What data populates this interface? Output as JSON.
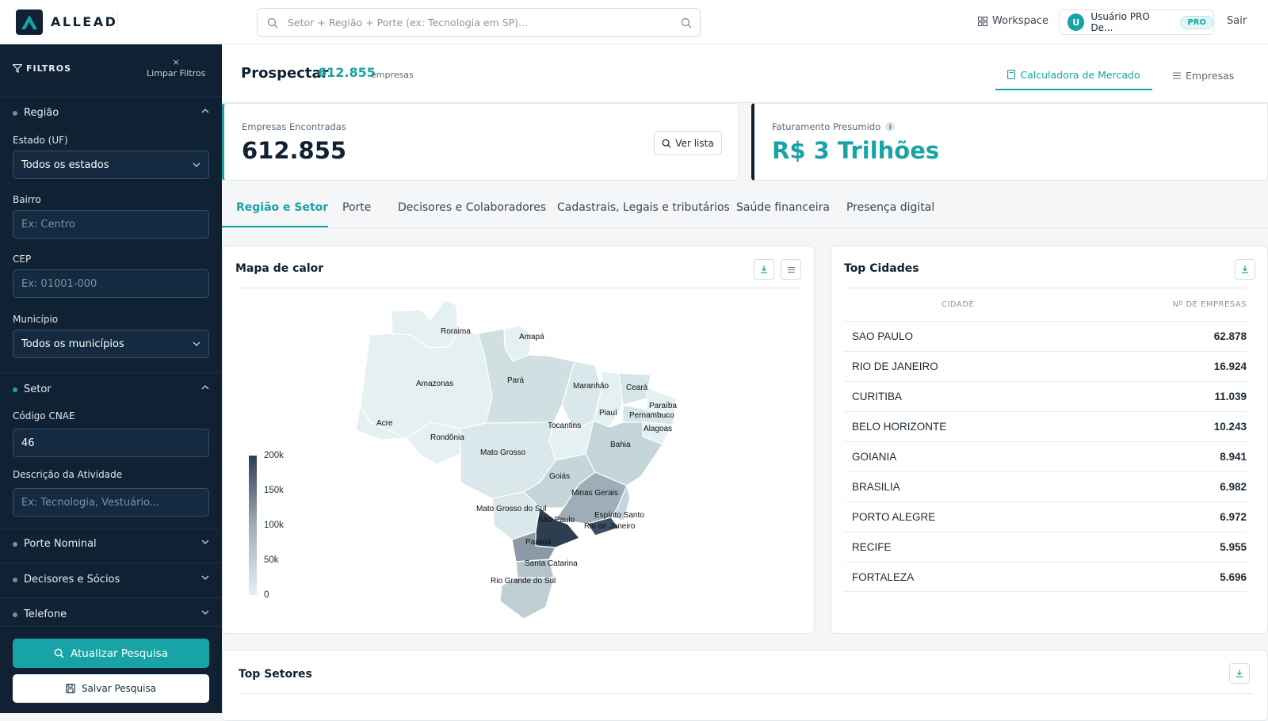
{
  "header": {
    "logo_text": "ALLEAD",
    "search_placeholder": "Setor + Região + Porte (ex: Tecnologia em SP)...",
    "workspace_label": "Workspace",
    "user_initial": "U",
    "user_name": "Usuário PRO De...",
    "user_badge": "PRO",
    "logout_label": "Sair"
  },
  "sidebar": {
    "filters_title": "FILTROS",
    "clear_label": "Limpar Filtros",
    "sections": {
      "regiao": "Região",
      "setor": "Setor",
      "porte": "Porte Nominal",
      "decisores": "Decisores e Sócios",
      "telefone": "Telefone"
    },
    "fields": {
      "estado_label": "Estado (UF)",
      "estado_value": "Todos os estados",
      "bairro_label": "Bairro",
      "bairro_placeholder": "Ex: Centro",
      "cep_label": "CEP",
      "cep_placeholder": "Ex: 01001-000",
      "municipio_label": "Município",
      "municipio_value": "Todos os municípios",
      "cnae_label": "Código CNAE",
      "cnae_value": "46",
      "descricao_label": "Descrição da Atividade",
      "descricao_placeholder": "Ex: Tecnologia, Vestuário..."
    },
    "update_button": "Atualizar Pesquisa",
    "save_button": "Salvar Pesquisa"
  },
  "page": {
    "title": "Prospectar",
    "count": "612.855",
    "count_unit": "empresas",
    "tab_calculadora": "Calculadora de Mercado",
    "tab_empresas": "Empresas"
  },
  "cards": {
    "empresas_label": "Empresas Encontradas",
    "empresas_value": "612.855",
    "ver_lista": "Ver lista",
    "faturamento_label": "Faturamento Presumido",
    "faturamento_info": "i",
    "faturamento_value": "R$ 3 Trilhões"
  },
  "subtabs": [
    "Região e Setor",
    "Porte",
    "Decisores e Colaboradores",
    "Cadastrais, Legais e tributários",
    "Saúde financeira",
    "Presença digital"
  ],
  "map": {
    "title": "Mapa de calor",
    "legend_ticks": [
      "200k",
      "150k",
      "100k",
      "50k",
      "0"
    ],
    "state_labels": [
      "Roraima",
      "Amapá",
      "Amazonas",
      "Pará",
      "Maranhão",
      "Ceará",
      "Paraíba",
      "Piauí",
      "Pernambuco",
      "Acre",
      "Tocantins",
      "Alagoas",
      "Rondônia",
      "Bahia",
      "Mato Grosso",
      "Goiás",
      "Minas Gerais",
      "Mato Grosso do Sul",
      "Espírito Santo",
      "São Paulo",
      "Rio de Janeiro",
      "Paraná",
      "Santa Catarina",
      "Rio Grande do Sul"
    ],
    "colors": {
      "low": "#e4f0f1",
      "mid": "#9fadb8",
      "high": "#2c3e50"
    }
  },
  "cities": {
    "title": "Top Cidades",
    "col_city": "CIDADE",
    "col_count": "Nº DE EMPRESAS",
    "rows": [
      {
        "name": "SAO PAULO",
        "value": "62.878"
      },
      {
        "name": "RIO DE JANEIRO",
        "value": "16.924"
      },
      {
        "name": "CURITIBA",
        "value": "11.039"
      },
      {
        "name": "BELO HORIZONTE",
        "value": "10.243"
      },
      {
        "name": "GOIANIA",
        "value": "8.941"
      },
      {
        "name": "BRASILIA",
        "value": "6.982"
      },
      {
        "name": "PORTO ALEGRE",
        "value": "6.972"
      },
      {
        "name": "RECIFE",
        "value": "5.955"
      },
      {
        "name": "FORTALEZA",
        "value": "5.696"
      }
    ]
  },
  "sectors": {
    "title": "Top Setores"
  },
  "colors": {
    "accent": "#18a3a6",
    "navy": "#0f2133"
  }
}
